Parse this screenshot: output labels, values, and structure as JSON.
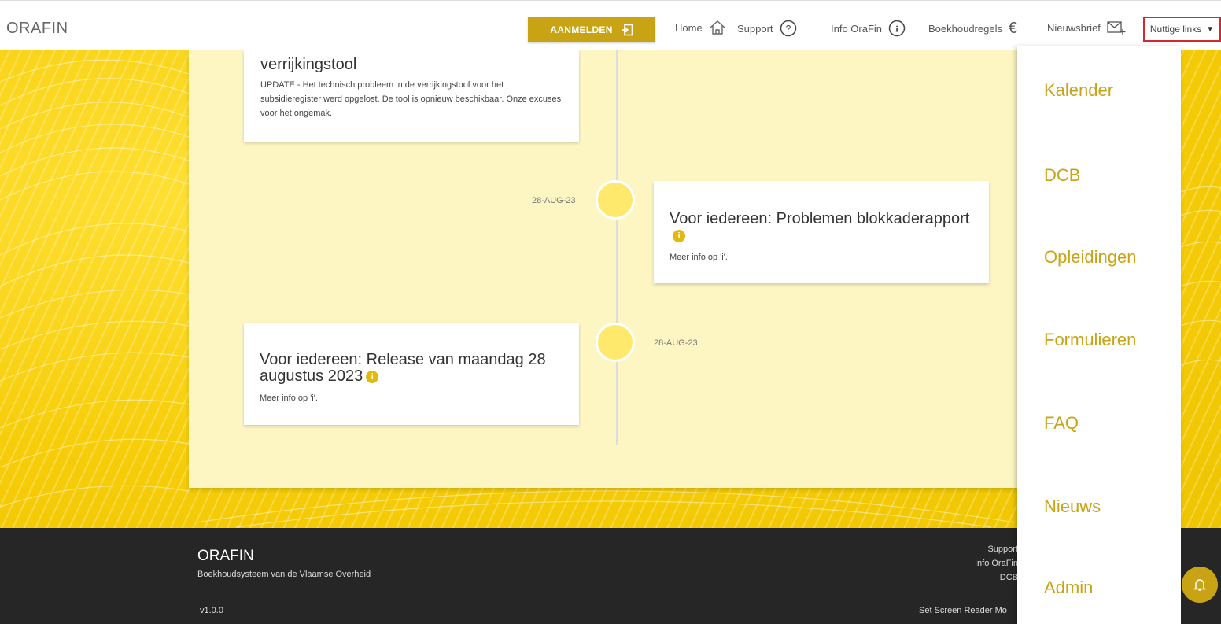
{
  "header": {
    "brand": "ORAFIN",
    "login_label": "AANMELDEN",
    "nav": [
      {
        "label": "Home",
        "icon": "home-icon"
      },
      {
        "label": "Support",
        "icon": "question-circle-icon"
      },
      {
        "label": "Info OraFin",
        "icon": "info-circle-icon"
      },
      {
        "label": "Boekhoudregels",
        "icon": "euro-icon"
      },
      {
        "label": "Nieuwsbrief",
        "icon": "mail-plus-icon"
      }
    ],
    "useful_links_label": "Nuttige links"
  },
  "timeline": {
    "top_card": {
      "title": "verrijkingstool",
      "body": "UPDATE - Het technisch probleem in de verrijkingstool voor het subsidieregister werd opgelost. De tool is opnieuw beschikbaar. Onze excuses voor het ongemak."
    },
    "items": [
      {
        "date": "28-AUG-23",
        "title": "Voor iedereen: Problemen blokkaderapport",
        "body": "Meer info op 'i'."
      },
      {
        "date": "28-AUG-23",
        "title": "Voor iedereen: Release van maandag 28 augustus 2023",
        "body": "Meer info op 'i'."
      }
    ]
  },
  "dropdown": {
    "items": [
      "Kalender",
      "DCB",
      "Opleidingen",
      "Formulieren",
      "FAQ",
      "Nieuws",
      "Admin"
    ]
  },
  "footer": {
    "title": "ORAFIN",
    "subtitle": "Boekhoudsysteem van de Vlaamse Overheid",
    "version": "v1.0.0",
    "links": [
      "Support",
      "Info OraFin",
      "DCB"
    ],
    "screen_reader": "Set Screen Reader Mo"
  },
  "colors": {
    "accent": "#c8a415",
    "hero": "#f6cd08",
    "panel": "#fdf6c3",
    "footer": "#262626"
  }
}
